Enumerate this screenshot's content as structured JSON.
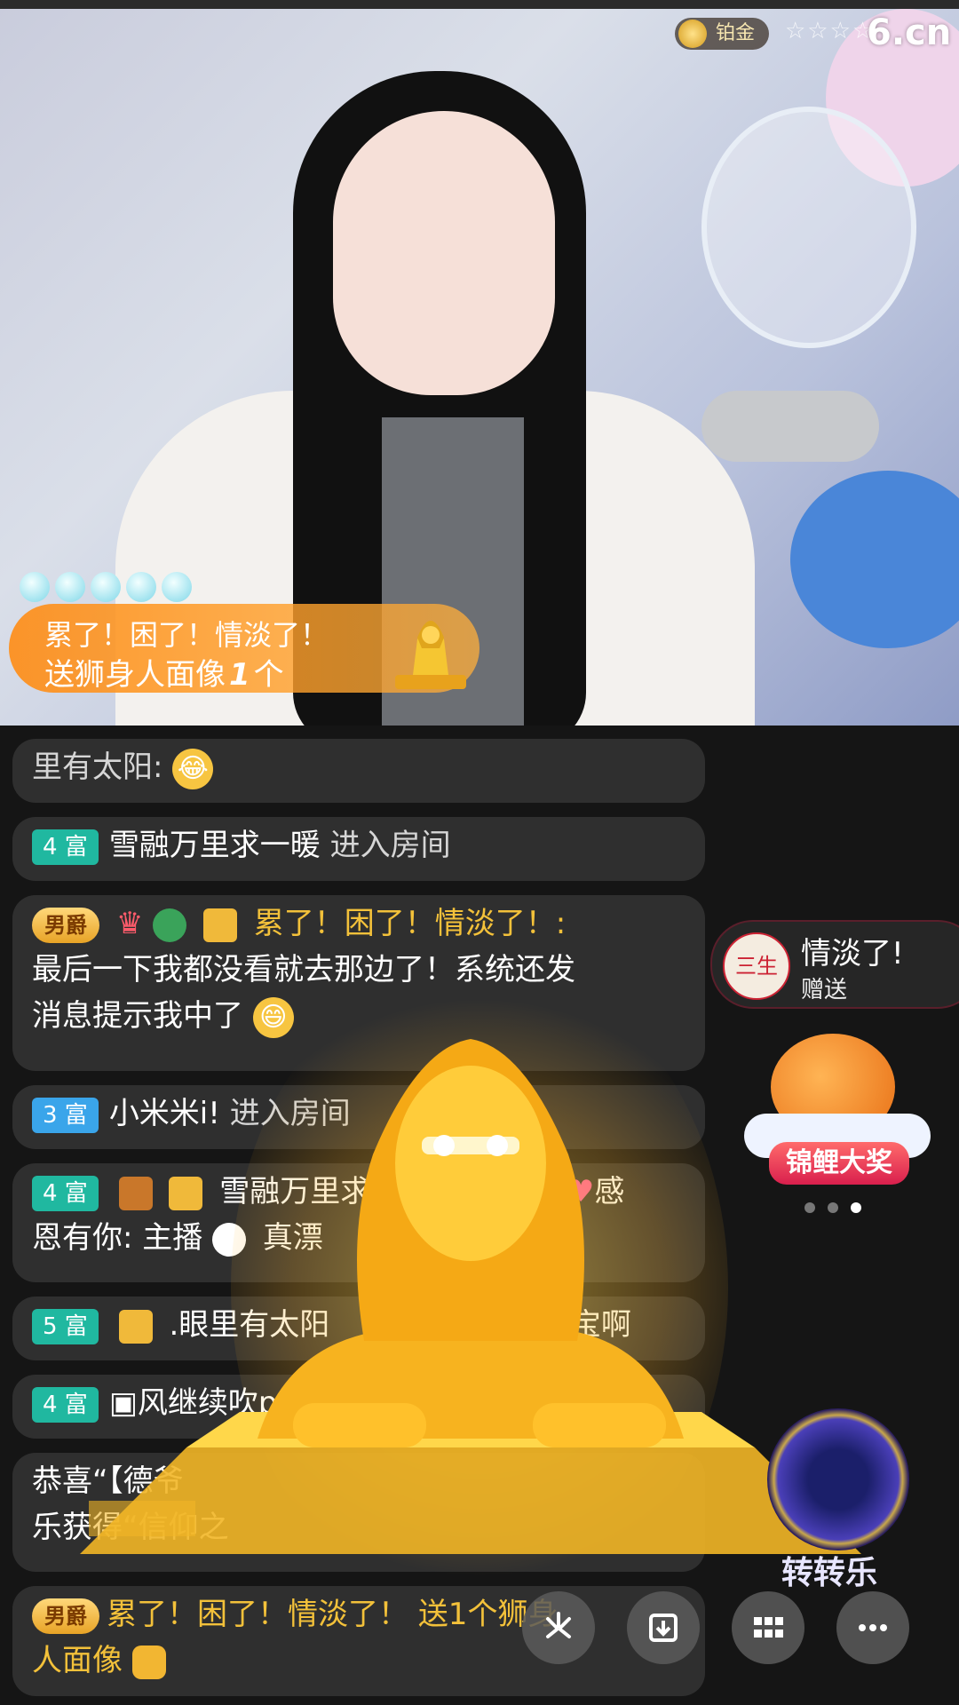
{
  "stream": {
    "platinum_label": "铂金",
    "stars": "☆☆☆☆",
    "site_logo": "6.cn"
  },
  "gift_banner": {
    "sender": "累了！困了！情淡了！",
    "action_prefix": "送狮身人面像",
    "count": "1",
    "unit": "个"
  },
  "chat": {
    "line0": {
      "text": "里有太阳:"
    },
    "line1": {
      "level": "4 富",
      "name": "雪融万里求一暖",
      "action": "进入房间"
    },
    "line2": {
      "noble": "男爵",
      "name": "累了！困了！情淡了！:",
      "text_a": "最后一下我都没看就去那边了！系统还发",
      "text_b": "消息提示我中了"
    },
    "line3": {
      "level": "3 富",
      "name": "小米米i!",
      "action": "进入房间"
    },
    "line4": {
      "level": "4 富",
      "name": "雪融万里求",
      "tail": "感",
      "text_b": "恩有你: 主播",
      "text_c": "真漂"
    },
    "line5": {
      "level": "5 富",
      "name": ".眼里有太阳",
      "tail": "宝啊"
    },
    "line6": {
      "level": "4 富",
      "name": "▣风继续吹p9"
    },
    "line7": {
      "text_a": "恭喜“【德爷",
      "text_b": "乐获得“信仰之"
    },
    "line8": {
      "noble": "男爵",
      "name": "累了！困了！情淡了！",
      "action": "送1个狮身",
      "text_b": "人面像"
    }
  },
  "gift_card": {
    "avatar_text": "三生",
    "name": "情淡了!",
    "action": "赠送"
  },
  "koi": {
    "label": "锦鲤大奖"
  },
  "wheel": {
    "label": "转转乐"
  },
  "colors": {
    "level_teal": "#20b8a0",
    "level_blue": "#3aa5ea",
    "gold_name": "#f3c13a",
    "banner_orange": "#ff8c14"
  }
}
